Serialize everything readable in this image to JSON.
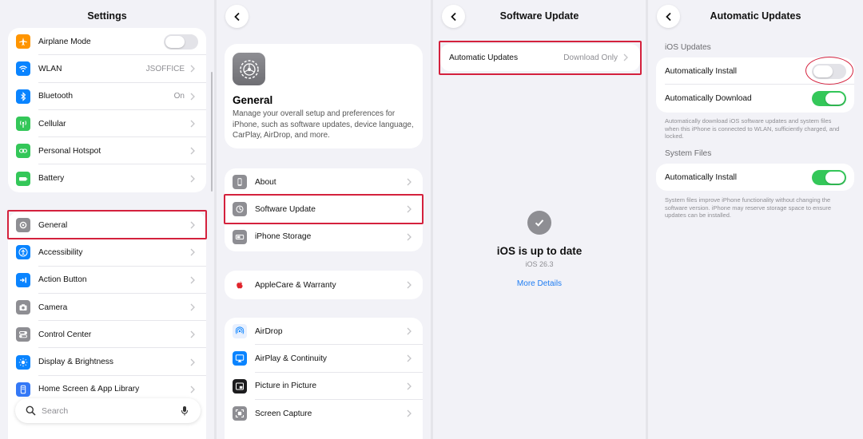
{
  "colors": {
    "highlight": "#d4213d",
    "toggle_on": "#34c759",
    "link": "#1e7cf2"
  },
  "settings": {
    "title": "Settings",
    "group1": [
      {
        "label": "Airplane Mode",
        "icon": "airplane-icon",
        "color": "#ff9500",
        "control": "toggle-off"
      },
      {
        "label": "WLAN",
        "icon": "wifi-icon",
        "color": "#0a84ff",
        "value": "JSOFFICE"
      },
      {
        "label": "Bluetooth",
        "icon": "bluetooth-icon",
        "color": "#0a84ff",
        "value": "On"
      },
      {
        "label": "Cellular",
        "icon": "antenna-icon",
        "color": "#34c759",
        "value": ""
      },
      {
        "label": "Personal Hotspot",
        "icon": "link-icon",
        "color": "#34c759",
        "value": ""
      },
      {
        "label": "Battery",
        "icon": "battery-icon",
        "color": "#34c759",
        "value": ""
      }
    ],
    "group2": [
      {
        "label": "General",
        "icon": "gear-icon",
        "color": "#8e8e93"
      },
      {
        "label": "Accessibility",
        "icon": "accessibility-icon",
        "color": "#0a84ff"
      },
      {
        "label": "Action Button",
        "icon": "action-button-icon",
        "color": "#0a84ff"
      },
      {
        "label": "Camera",
        "icon": "camera-icon",
        "color": "#8e8e93"
      },
      {
        "label": "Control Center",
        "icon": "sliders-icon",
        "color": "#8e8e93"
      },
      {
        "label": "Display & Brightness",
        "icon": "sun-icon",
        "color": "#0a84ff"
      },
      {
        "label": "Home Screen & App Library",
        "icon": "phone-icon",
        "color": "#3478f6"
      }
    ],
    "search_placeholder": "Search"
  },
  "general": {
    "title": "General",
    "description": "Manage your overall setup and preferences for iPhone, such as software updates, device language, CarPlay, AirDrop, and more.",
    "group1": [
      {
        "label": "About",
        "icon": "phone-icon",
        "color": "#8e8e93"
      },
      {
        "label": "Software Update",
        "icon": "gear-icon",
        "color": "#8e8e93"
      },
      {
        "label": "iPhone Storage",
        "icon": "storage-icon",
        "color": "#8e8e93"
      }
    ],
    "group2": [
      {
        "label": "AppleCare & Warranty",
        "icon": "apple-icon",
        "color": "#ffffff"
      }
    ],
    "group3": [
      {
        "label": "AirDrop",
        "icon": "airdrop-icon",
        "color": "#e8f0fe"
      },
      {
        "label": "AirPlay & Continuity",
        "icon": "airplay-icon",
        "color": "#0a84ff"
      },
      {
        "label": "Picture in Picture",
        "icon": "pip-icon",
        "color": "#1c1c1e"
      },
      {
        "label": "Screen Capture",
        "icon": "screen-capture-icon",
        "color": "#8e8e93"
      }
    ]
  },
  "software_update": {
    "title": "Software Update",
    "auto_updates_label": "Automatic Updates",
    "auto_updates_value": "Download Only",
    "status_title": "iOS is up to date",
    "version": "iOS 26.3",
    "more_details": "More Details"
  },
  "automatic_updates": {
    "title": "Automatic Updates",
    "ios_header": "iOS Updates",
    "ios_rows": [
      {
        "label": "Automatically Install",
        "on": false
      },
      {
        "label": "Automatically Download",
        "on": true
      }
    ],
    "ios_footnote": "Automatically download iOS software updates and system files when this iPhone is connected to WLAN, sufficiently charged, and locked.",
    "system_header": "System Files",
    "system_rows": [
      {
        "label": "Automatically Install",
        "on": true
      }
    ],
    "system_footnote": "System files improve iPhone functionality without changing the software version. iPhone may reserve storage space to ensure updates can be installed."
  }
}
